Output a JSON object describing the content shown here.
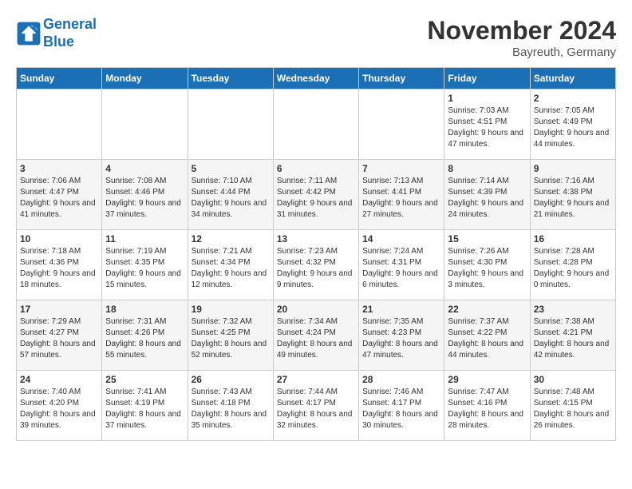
{
  "header": {
    "logo_line1": "General",
    "logo_line2": "Blue",
    "month": "November 2024",
    "location": "Bayreuth, Germany"
  },
  "days_of_week": [
    "Sunday",
    "Monday",
    "Tuesday",
    "Wednesday",
    "Thursday",
    "Friday",
    "Saturday"
  ],
  "weeks": [
    [
      {
        "day": "",
        "sunrise": "",
        "sunset": "",
        "daylight": ""
      },
      {
        "day": "",
        "sunrise": "",
        "sunset": "",
        "daylight": ""
      },
      {
        "day": "",
        "sunrise": "",
        "sunset": "",
        "daylight": ""
      },
      {
        "day": "",
        "sunrise": "",
        "sunset": "",
        "daylight": ""
      },
      {
        "day": "",
        "sunrise": "",
        "sunset": "",
        "daylight": ""
      },
      {
        "day": "1",
        "sunrise": "Sunrise: 7:03 AM",
        "sunset": "Sunset: 4:51 PM",
        "daylight": "Daylight: 9 hours and 47 minutes."
      },
      {
        "day": "2",
        "sunrise": "Sunrise: 7:05 AM",
        "sunset": "Sunset: 4:49 PM",
        "daylight": "Daylight: 9 hours and 44 minutes."
      }
    ],
    [
      {
        "day": "3",
        "sunrise": "Sunrise: 7:06 AM",
        "sunset": "Sunset: 4:47 PM",
        "daylight": "Daylight: 9 hours and 41 minutes."
      },
      {
        "day": "4",
        "sunrise": "Sunrise: 7:08 AM",
        "sunset": "Sunset: 4:46 PM",
        "daylight": "Daylight: 9 hours and 37 minutes."
      },
      {
        "day": "5",
        "sunrise": "Sunrise: 7:10 AM",
        "sunset": "Sunset: 4:44 PM",
        "daylight": "Daylight: 9 hours and 34 minutes."
      },
      {
        "day": "6",
        "sunrise": "Sunrise: 7:11 AM",
        "sunset": "Sunset: 4:42 PM",
        "daylight": "Daylight: 9 hours and 31 minutes."
      },
      {
        "day": "7",
        "sunrise": "Sunrise: 7:13 AM",
        "sunset": "Sunset: 4:41 PM",
        "daylight": "Daylight: 9 hours and 27 minutes."
      },
      {
        "day": "8",
        "sunrise": "Sunrise: 7:14 AM",
        "sunset": "Sunset: 4:39 PM",
        "daylight": "Daylight: 9 hours and 24 minutes."
      },
      {
        "day": "9",
        "sunrise": "Sunrise: 7:16 AM",
        "sunset": "Sunset: 4:38 PM",
        "daylight": "Daylight: 9 hours and 21 minutes."
      }
    ],
    [
      {
        "day": "10",
        "sunrise": "Sunrise: 7:18 AM",
        "sunset": "Sunset: 4:36 PM",
        "daylight": "Daylight: 9 hours and 18 minutes."
      },
      {
        "day": "11",
        "sunrise": "Sunrise: 7:19 AM",
        "sunset": "Sunset: 4:35 PM",
        "daylight": "Daylight: 9 hours and 15 minutes."
      },
      {
        "day": "12",
        "sunrise": "Sunrise: 7:21 AM",
        "sunset": "Sunset: 4:34 PM",
        "daylight": "Daylight: 9 hours and 12 minutes."
      },
      {
        "day": "13",
        "sunrise": "Sunrise: 7:23 AM",
        "sunset": "Sunset: 4:32 PM",
        "daylight": "Daylight: 9 hours and 9 minutes."
      },
      {
        "day": "14",
        "sunrise": "Sunrise: 7:24 AM",
        "sunset": "Sunset: 4:31 PM",
        "daylight": "Daylight: 9 hours and 6 minutes."
      },
      {
        "day": "15",
        "sunrise": "Sunrise: 7:26 AM",
        "sunset": "Sunset: 4:30 PM",
        "daylight": "Daylight: 9 hours and 3 minutes."
      },
      {
        "day": "16",
        "sunrise": "Sunrise: 7:28 AM",
        "sunset": "Sunset: 4:28 PM",
        "daylight": "Daylight: 9 hours and 0 minutes."
      }
    ],
    [
      {
        "day": "17",
        "sunrise": "Sunrise: 7:29 AM",
        "sunset": "Sunset: 4:27 PM",
        "daylight": "Daylight: 8 hours and 57 minutes."
      },
      {
        "day": "18",
        "sunrise": "Sunrise: 7:31 AM",
        "sunset": "Sunset: 4:26 PM",
        "daylight": "Daylight: 8 hours and 55 minutes."
      },
      {
        "day": "19",
        "sunrise": "Sunrise: 7:32 AM",
        "sunset": "Sunset: 4:25 PM",
        "daylight": "Daylight: 8 hours and 52 minutes."
      },
      {
        "day": "20",
        "sunrise": "Sunrise: 7:34 AM",
        "sunset": "Sunset: 4:24 PM",
        "daylight": "Daylight: 8 hours and 49 minutes."
      },
      {
        "day": "21",
        "sunrise": "Sunrise: 7:35 AM",
        "sunset": "Sunset: 4:23 PM",
        "daylight": "Daylight: 8 hours and 47 minutes."
      },
      {
        "day": "22",
        "sunrise": "Sunrise: 7:37 AM",
        "sunset": "Sunset: 4:22 PM",
        "daylight": "Daylight: 8 hours and 44 minutes."
      },
      {
        "day": "23",
        "sunrise": "Sunrise: 7:38 AM",
        "sunset": "Sunset: 4:21 PM",
        "daylight": "Daylight: 8 hours and 42 minutes."
      }
    ],
    [
      {
        "day": "24",
        "sunrise": "Sunrise: 7:40 AM",
        "sunset": "Sunset: 4:20 PM",
        "daylight": "Daylight: 8 hours and 39 minutes."
      },
      {
        "day": "25",
        "sunrise": "Sunrise: 7:41 AM",
        "sunset": "Sunset: 4:19 PM",
        "daylight": "Daylight: 8 hours and 37 minutes."
      },
      {
        "day": "26",
        "sunrise": "Sunrise: 7:43 AM",
        "sunset": "Sunset: 4:18 PM",
        "daylight": "Daylight: 8 hours and 35 minutes."
      },
      {
        "day": "27",
        "sunrise": "Sunrise: 7:44 AM",
        "sunset": "Sunset: 4:17 PM",
        "daylight": "Daylight: 8 hours and 32 minutes."
      },
      {
        "day": "28",
        "sunrise": "Sunrise: 7:46 AM",
        "sunset": "Sunset: 4:17 PM",
        "daylight": "Daylight: 8 hours and 30 minutes."
      },
      {
        "day": "29",
        "sunrise": "Sunrise: 7:47 AM",
        "sunset": "Sunset: 4:16 PM",
        "daylight": "Daylight: 8 hours and 28 minutes."
      },
      {
        "day": "30",
        "sunrise": "Sunrise: 7:48 AM",
        "sunset": "Sunset: 4:15 PM",
        "daylight": "Daylight: 8 hours and 26 minutes."
      }
    ]
  ]
}
